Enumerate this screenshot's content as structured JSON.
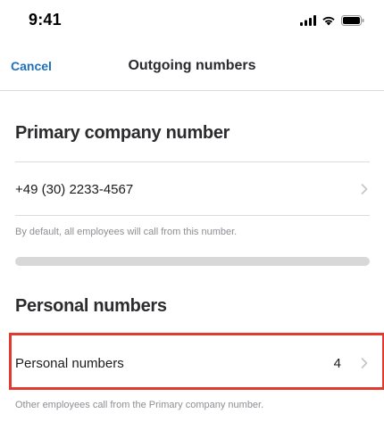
{
  "status_bar": {
    "time": "9:41",
    "icons": [
      "cellular-signal-icon",
      "wifi-icon",
      "battery-icon"
    ]
  },
  "nav": {
    "cancel_label": "Cancel",
    "title": "Outgoing numbers"
  },
  "primary_section": {
    "title": "Primary company number",
    "number": "+49 (30) 2233-4567",
    "footnote": "By default, all employees will call from this number."
  },
  "personal_section": {
    "title": "Personal numbers",
    "row_label": "Personal numbers",
    "count": "4",
    "footnote": "Other employees call from the Primary company number."
  },
  "colors": {
    "accent": "#1f6fbd",
    "highlight": "#e03a31",
    "muted_text": "#8e8e93",
    "divider": "#dcdce0"
  }
}
